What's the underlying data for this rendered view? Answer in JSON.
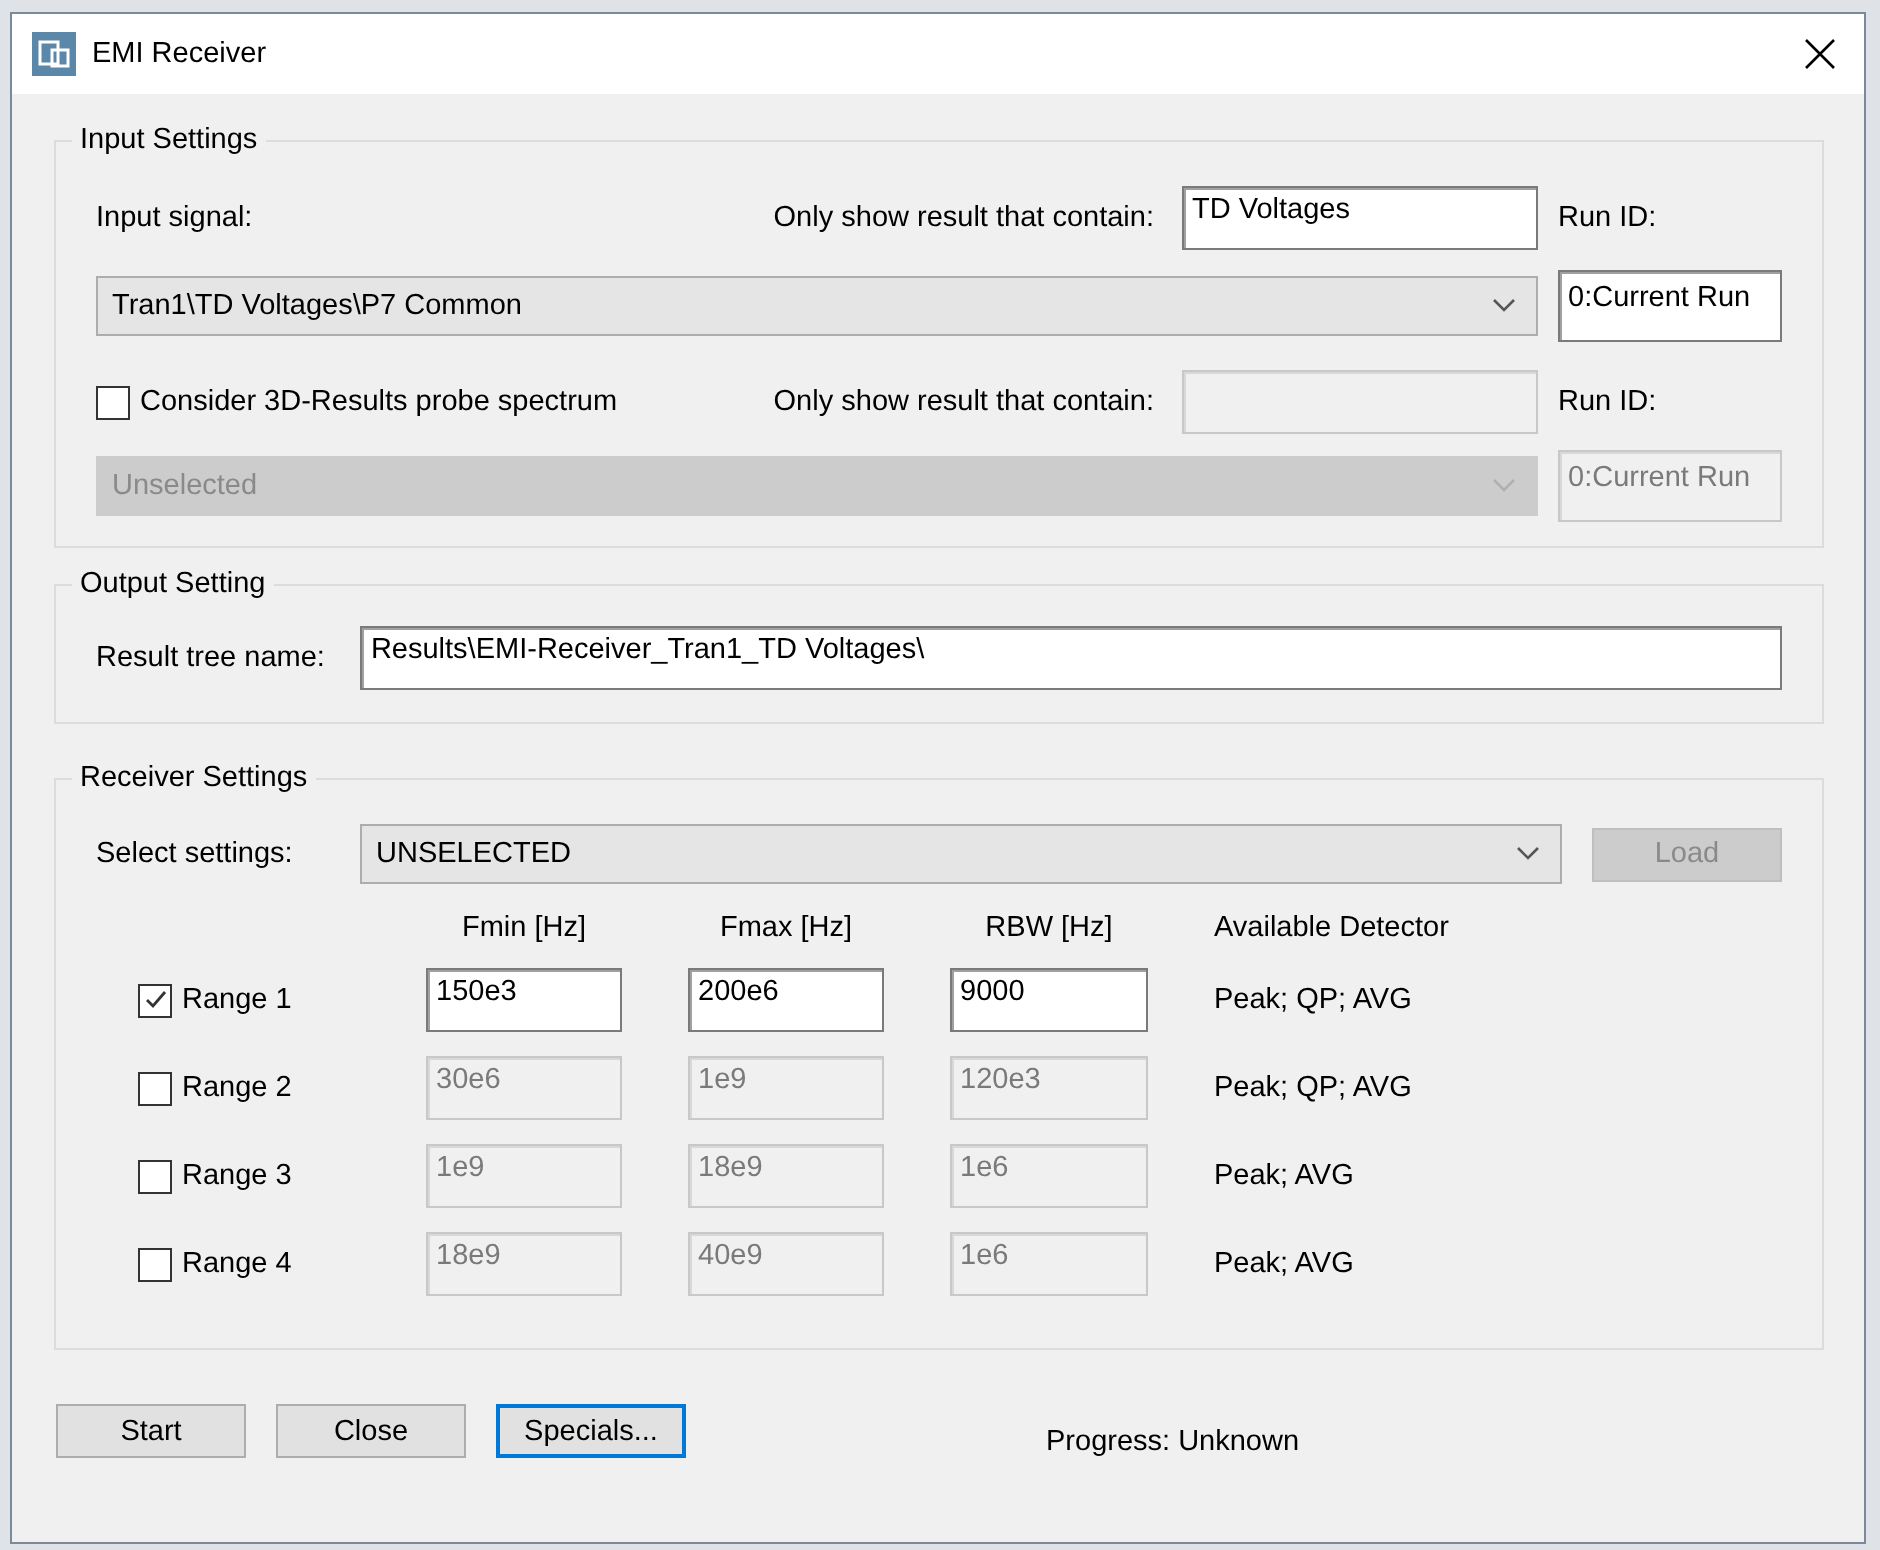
{
  "window": {
    "title": "EMI Receiver"
  },
  "input_settings": {
    "title": "Input Settings",
    "input_signal_label": "Input signal:",
    "filter_label": "Only show result that contain:",
    "filter_value": "TD Voltages",
    "run_id_label": "Run ID:",
    "signal": "Tran1\\TD Voltages\\P7 Common",
    "run_id": "0:Current Run",
    "probe": {
      "label": "Consider 3D-Results probe spectrum",
      "checked": false
    },
    "probe_filter_label": "Only show result that contain:",
    "probe_run_id_label": "Run ID:",
    "probe_signal": "Unselected",
    "probe_run_id": "0:Current Run"
  },
  "output_setting": {
    "title": "Output Setting",
    "label": "Result tree name:",
    "value": "Results\\EMI-Receiver_Tran1_TD Voltages\\"
  },
  "receiver_settings": {
    "title": "Receiver Settings",
    "select_label": "Select settings:",
    "select_value": "UNSELECTED",
    "load": {
      "label": "Load",
      "disabled": true
    },
    "columns": [
      "Fmin [Hz]",
      "Fmax [Hz]",
      "RBW [Hz]",
      "Available Detector"
    ],
    "ranges": [
      {
        "label": "Range 1",
        "checked": true,
        "fmin": "150e3",
        "fmax": "200e6",
        "rbw": "9000",
        "detectors": "Peak; QP; AVG"
      },
      {
        "label": "Range 2",
        "checked": false,
        "fmin": "30e6",
        "fmax": "1e9",
        "rbw": "120e3",
        "detectors": "Peak; QP; AVG"
      },
      {
        "label": "Range 3",
        "checked": false,
        "fmin": "1e9",
        "fmax": "18e9",
        "rbw": "1e6",
        "detectors": "Peak; AVG"
      },
      {
        "label": "Range 4",
        "checked": false,
        "fmin": "18e9",
        "fmax": "40e9",
        "rbw": "1e6",
        "detectors": "Peak; AVG"
      }
    ]
  },
  "buttons": [
    {
      "label": "Start",
      "focused": false
    },
    {
      "label": "Close",
      "focused": false
    },
    {
      "label": "Specials...",
      "focused": true
    }
  ],
  "progress": "Progress: Unknown"
}
